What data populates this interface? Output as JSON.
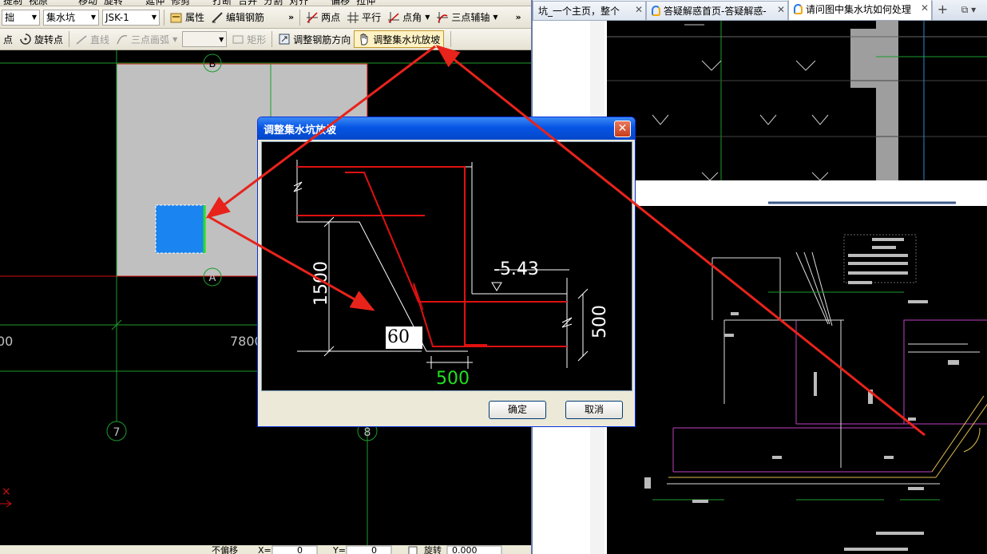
{
  "cad": {
    "top_row": [
      "提制",
      "视原",
      "移动",
      "旋转",
      "延伸",
      "修剪",
      "打断",
      "合并",
      "分割",
      "对齐",
      "偏移",
      "拉伸"
    ],
    "row1": {
      "combo_type": "拙",
      "combo_component": "集水坑",
      "combo_name": "JSK-1",
      "property": "属性",
      "edit_rebar": "编辑钢筋",
      "two_points": "两点",
      "parallel": "平行",
      "point_angle": "点角",
      "three_point_axis": "三点辅轴"
    },
    "row2": {
      "point": "点",
      "rotate_point": "旋转点",
      "line": "直线",
      "three_point_arc": "三点画弧",
      "rectangle": "矩形",
      "adjust_rebar_dir": "调整钢筋方向",
      "adjust_pit_slope": "调整集水坑放坡"
    },
    "axes": {
      "b": "B",
      "a": "A",
      "seven": "7",
      "eight": "8"
    },
    "dims": {
      "left": "00",
      "mid": "7800"
    },
    "status": {
      "offset_mode": "不偏移",
      "x_label": "X=",
      "x_value": "0",
      "y_label": "Y=",
      "y_value": "0",
      "rotate_label": "旋转",
      "rotate_value": "0.000"
    }
  },
  "dialog": {
    "title": "调整集水坑放坡",
    "close": "✕",
    "elevation": "-5.43",
    "depth": "1500",
    "pit_height": "500",
    "bottom_width": "500",
    "slope_angle": "60",
    "ok": "确定",
    "cancel": "取消"
  },
  "browser": {
    "tabs": [
      {
        "label": "坑_一个主页，整个",
        "active": false
      },
      {
        "label": "答疑解惑首页-答疑解惑-",
        "active": false
      },
      {
        "label": "请问图中集水坑如何处理",
        "active": true
      }
    ],
    "new_tab": "+",
    "window_btn": "⧉ ▾"
  },
  "colors": {
    "annotation_arrow": "#e8231b",
    "pit_fill": "#1a84f0",
    "axis_green": "#1d9b2c",
    "cad_gray": "#c0c0c0"
  }
}
